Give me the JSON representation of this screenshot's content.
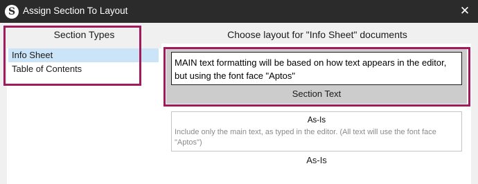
{
  "window": {
    "title": "Assign Section To Layout",
    "app_icon_letter": "S",
    "close_glyph": "✕"
  },
  "section_types": {
    "header": "Section Types",
    "items": [
      {
        "label": "Info Sheet",
        "selected": true
      },
      {
        "label": "Table of Contents",
        "selected": false
      }
    ]
  },
  "layouts": {
    "header": "Choose layout for \"Info Sheet\" documents",
    "options": [
      {
        "preview_text": "MAIN text formatting will be based on how text appears in the editor, but using the font face \"Aptos\"",
        "name": "Section Text",
        "selected": true
      },
      {
        "preview_title": "As-Is",
        "preview_desc": "Include only the main text, as typed in the editor. (All text will use the font face \"Aptos\")",
        "name": "As-Is",
        "selected": false
      }
    ]
  },
  "colors": {
    "titlebar": "#2b2b2b",
    "selection": "#cce4f7",
    "highlight": "#a01a5c",
    "selected_layout_bg": "#cccccc"
  }
}
